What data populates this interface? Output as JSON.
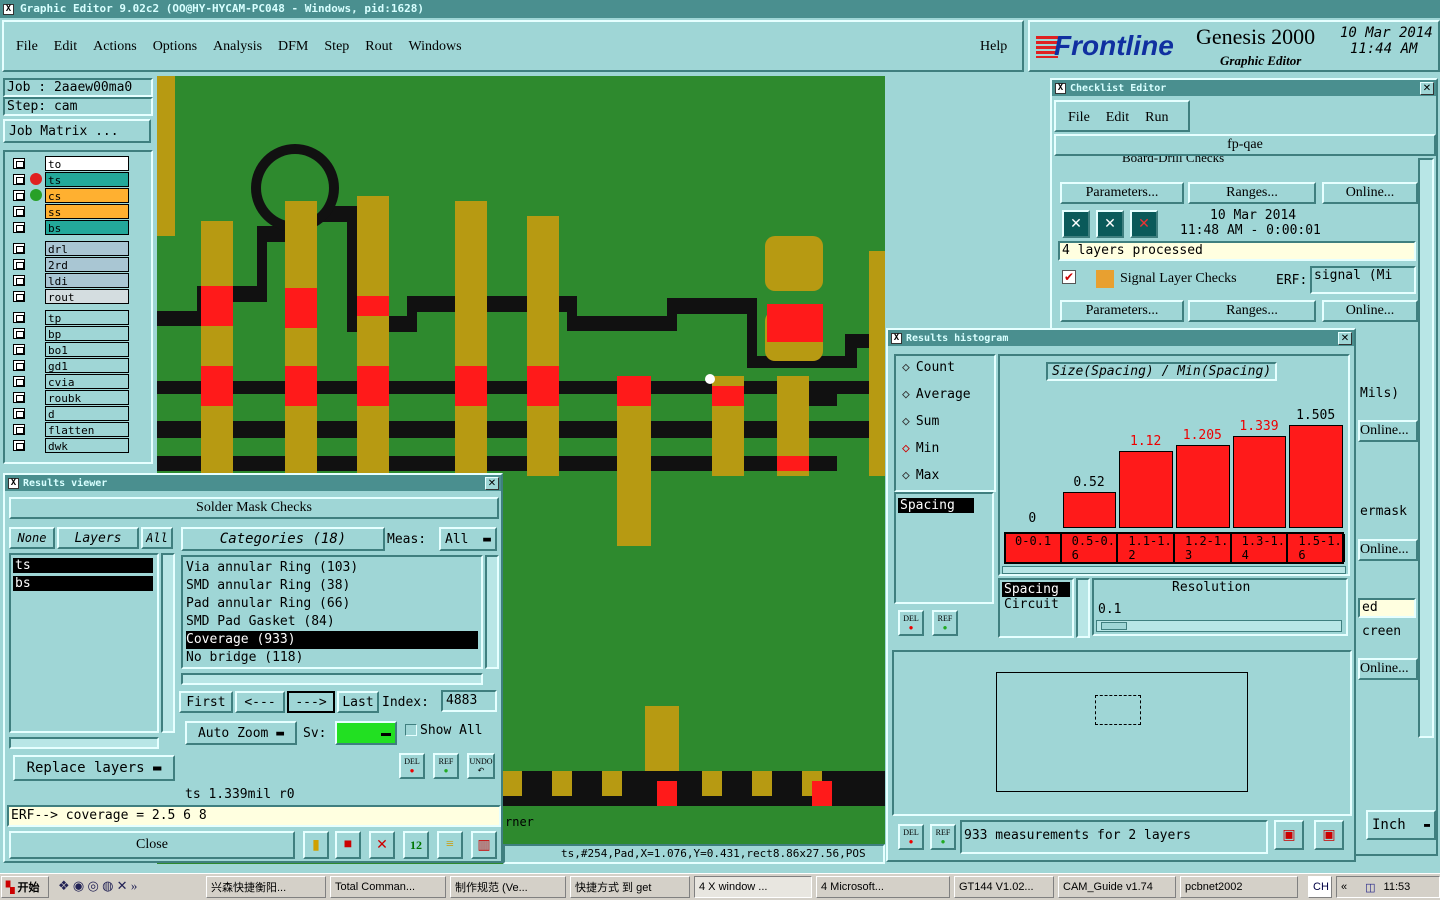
{
  "window_title": "Graphic Editor 9.02c2  (OO@HY-HYCAM-PC048 - Windows, pid:1628)",
  "menu": [
    "File",
    "Edit",
    "Actions",
    "Options",
    "Analysis",
    "DFM",
    "Step",
    "Rout",
    "Windows"
  ],
  "help": "Help",
  "brand": {
    "logo": "Frontline",
    "product": "Genesis 2000",
    "subtitle": "Graphic Editor",
    "date": "10 Mar 2014",
    "time": "11:44 AM"
  },
  "job": {
    "job_label": "Job  : 2aaew00ma0",
    "step_label": "Step: cam",
    "matrix_btn": "Job Matrix ..."
  },
  "layers": [
    {
      "name": "to",
      "color": "#ffffff"
    },
    {
      "name": "ts",
      "color": "#23a89a"
    },
    {
      "name": "cs",
      "color": "#ffb030"
    },
    {
      "name": "ss",
      "color": "#ffb030"
    },
    {
      "name": "bs",
      "color": "#23a89a"
    },
    {
      "name": "drl",
      "color": "#a9c6d3"
    },
    {
      "name": "2rd",
      "color": "#a9c6d3"
    },
    {
      "name": "ldi",
      "color": "#a9c6d3"
    },
    {
      "name": "rout",
      "color": "#d4dde0"
    },
    {
      "name": "tp",
      "color": "#9fd6d6"
    },
    {
      "name": "bp",
      "color": "#9fd6d6"
    },
    {
      "name": "bo1",
      "color": "#9fd6d6"
    },
    {
      "name": "gd1",
      "color": "#9fd6d6"
    },
    {
      "name": "cvia",
      "color": "#9fd6d6"
    },
    {
      "name": "roubk",
      "color": "#9fd6d6"
    },
    {
      "name": "d",
      "color": "#9fd6d6"
    },
    {
      "name": "flatten",
      "color": "#9fd6d6"
    },
    {
      "name": "dwk",
      "color": "#9fd6d6"
    }
  ],
  "results_viewer": {
    "title": "Results viewer",
    "header": "Solder Mask Checks",
    "btn_none": "None",
    "btn_layers": "Layers",
    "btn_all": "All",
    "layer_list": [
      "ts",
      "bs"
    ],
    "categories_label": "Categories (18)",
    "meas_label": "Meas:",
    "meas_value": "All",
    "categories": [
      "Via annular Ring (103)",
      "SMD annular Ring (38)",
      "Pad annular Ring (66)",
      "SMD Pad Gasket (84)",
      "Coverage (933)",
      "No bridge (118)"
    ],
    "selected_category": "Coverage (933)",
    "nav": {
      "first": "First",
      "prev": "<---",
      "next": "--->",
      "last": "Last",
      "index_label": "Index:",
      "index_value": "4883"
    },
    "auto_zoom": "Auto Zoom",
    "sv_label": "Sv:",
    "show_all": "Show All",
    "replace_layers": "Replace layers",
    "status": "ts 1.339mil   r0",
    "erf": "ERF--> coverage = 2.5 6 8",
    "close": "Close",
    "small_btns": {
      "del": "DEL",
      "ref": "REF",
      "undo": "UNDO"
    }
  },
  "checklist": {
    "title": "Checklist Editor",
    "menu": [
      "File",
      "Edit",
      "Run"
    ],
    "name": "fp-qae",
    "row1": "Board-Drill Checks",
    "erf_label": "ERF:",
    "params": "Parameters...",
    "ranges": "Ranges...",
    "online": "Online...",
    "date": "10 Mar 2014",
    "time": "11:48 AM - 0:00:01",
    "processed": "4 layers processed",
    "row2": "Signal Layer Checks",
    "row2_erf": "signal (Mi",
    "side_texts": [
      "Mils)",
      "ermask",
      "ed",
      "creen"
    ]
  },
  "histogram": {
    "title": "Results histogram",
    "options": [
      "Count",
      "Average",
      "Sum",
      "Min",
      "Max"
    ],
    "selected_option": "Min",
    "chart_title": "Size(Spacing) / Min(Spacing)",
    "list": [
      "Spacing"
    ],
    "bottom_list": [
      "Spacing",
      "Circuit"
    ],
    "resolution_label": "Resolution",
    "resolution_value": "0.1",
    "footer": "933 measurements for 2 layers",
    "small_btns": {
      "del": "DEL",
      "ref": "REF"
    }
  },
  "chart_data": {
    "type": "bar",
    "title": "Size(Spacing) / Min(Spacing)",
    "categories": [
      "0-0.1",
      "0.5-0.6",
      "1.1-1.2",
      "1.2-1.3",
      "1.3-1.4",
      "1.5-1.6"
    ],
    "values": [
      0,
      0.52,
      1.12,
      1.205,
      1.339,
      1.505
    ],
    "value_labels": [
      "0",
      "0.52",
      "1.12",
      "1.205",
      "1.339",
      "1.505"
    ],
    "label_colors": [
      "#000",
      "#000",
      "#e00",
      "#e00",
      "#e00",
      "#000"
    ],
    "ylim": [
      0,
      1.6
    ]
  },
  "status_bar": {
    "coords": "ts,#254,Pad,X=1.076,Y=0.431,rect8.86x27.56,POS",
    "corner": "rner",
    "units": "Inch"
  },
  "taskbar": {
    "start": "开始",
    "items": [
      "兴森快捷衡阳...",
      "Total Comman...",
      "制作规范 (Ve...",
      "快捷方式 到 get",
      "4 X window ...",
      "4 Microsoft...",
      "GT144 V1.02...",
      "CAM_Guide v1.74",
      "pcbnet2002"
    ],
    "lang": "CH",
    "clock": "11:53"
  }
}
